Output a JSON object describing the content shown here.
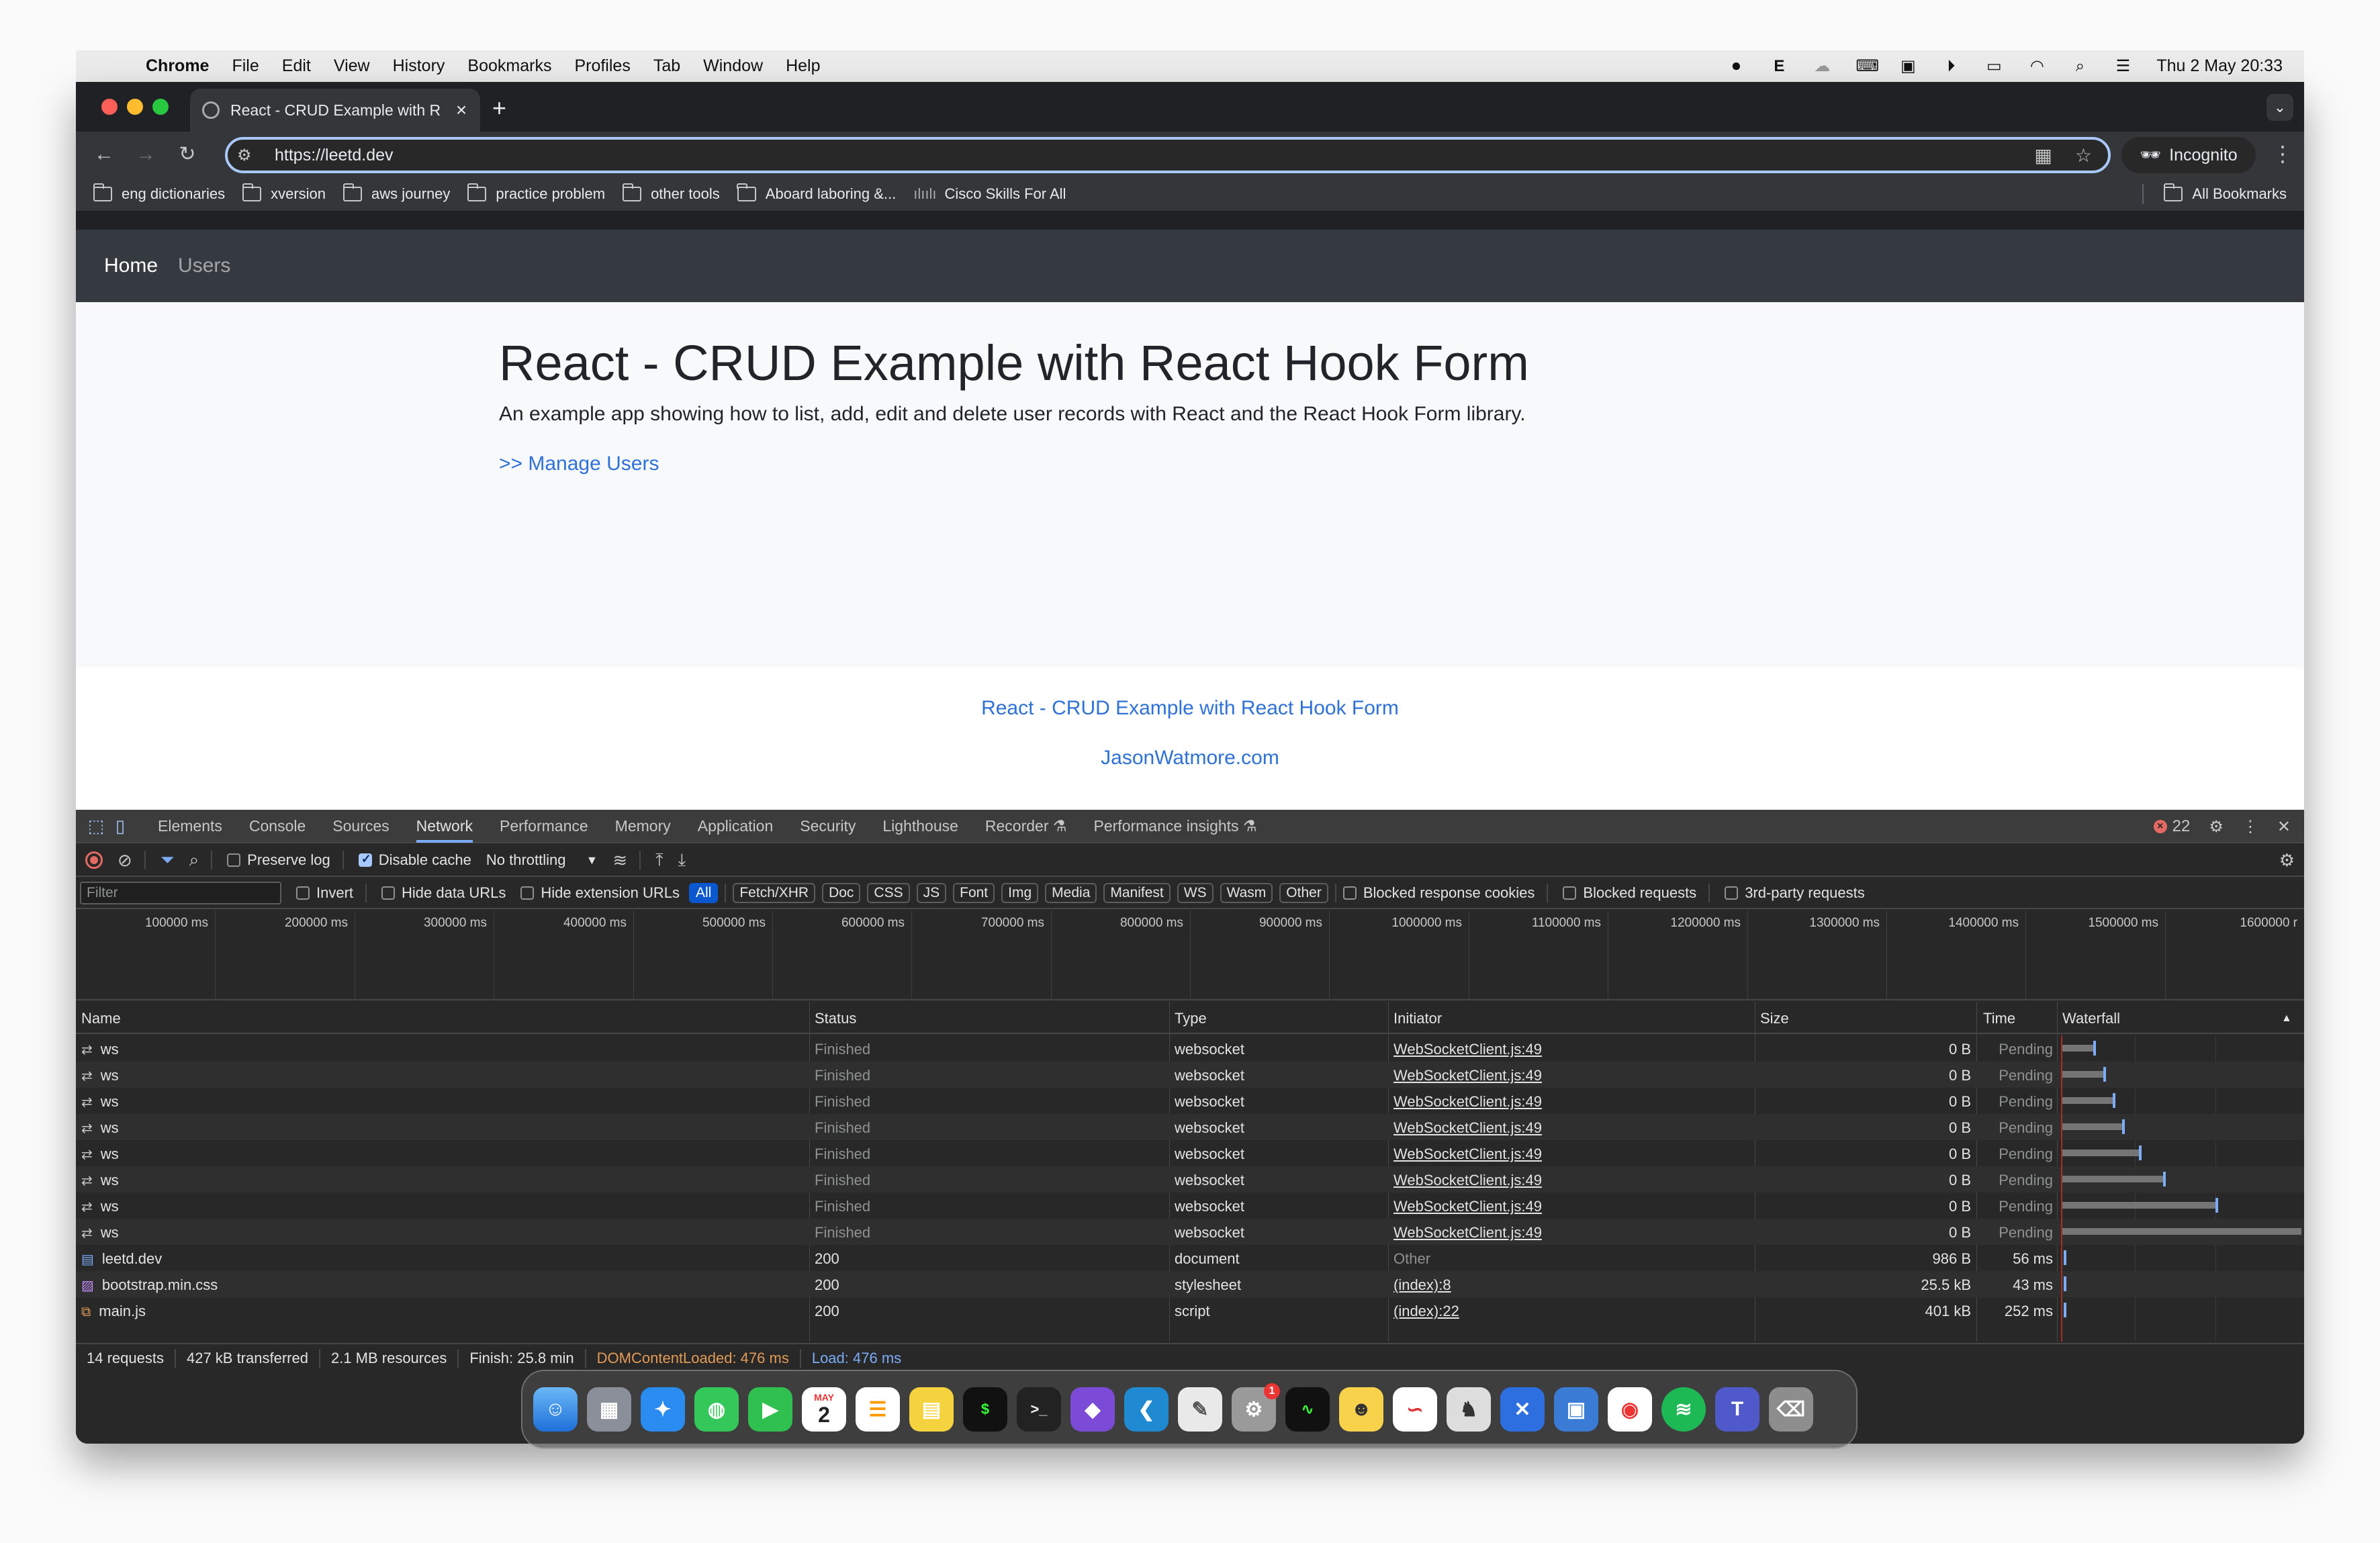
{
  "menubar": {
    "items": [
      "Chrome",
      "File",
      "Edit",
      "View",
      "History",
      "Bookmarks",
      "Profiles",
      "Tab",
      "Window",
      "Help"
    ],
    "datetime": "Thu 2 May  20:33"
  },
  "tab": {
    "title": "React - CRUD Example with R"
  },
  "omnibox": {
    "url": "https://leetd.dev"
  },
  "incognito_label": "Incognito",
  "bookmarks": [
    "eng dictionaries",
    "xversion",
    "aws journey",
    "practice problem",
    "other tools",
    "Aboard laboring &...",
    "Cisco Skills For All"
  ],
  "all_bookmarks": "All Bookmarks",
  "app": {
    "nav_home": "Home",
    "nav_users": "Users",
    "title": "React - CRUD Example with React Hook Form",
    "lead": "An example app showing how to list, add, edit and delete user records with React and the React Hook Form library.",
    "manage_link": ">> Manage Users",
    "footer_link1": "React - CRUD Example with React Hook Form",
    "footer_link2": "JasonWatmore.com"
  },
  "devtools": {
    "tabs": [
      "Elements",
      "Console",
      "Sources",
      "Network",
      "Performance",
      "Memory",
      "Application",
      "Security",
      "Lighthouse",
      "Recorder ⚗",
      "Performance insights ⚗"
    ],
    "active_tab": "Network",
    "error_count": "22",
    "toolbar": {
      "preserve_log": "Preserve log",
      "disable_cache": "Disable cache",
      "throttling": "No throttling"
    },
    "filter": {
      "placeholder": "Filter",
      "invert": "Invert",
      "hide_data_urls": "Hide data URLs",
      "hide_ext_urls": "Hide extension URLs",
      "types": [
        "All",
        "Fetch/XHR",
        "Doc",
        "CSS",
        "JS",
        "Font",
        "Img",
        "Media",
        "Manifest",
        "WS",
        "Wasm",
        "Other"
      ],
      "blocked_cookies": "Blocked response cookies",
      "blocked_requests": "Blocked requests",
      "third_party": "3rd-party requests"
    },
    "overview_ticks": [
      "100000 ms",
      "200000 ms",
      "300000 ms",
      "400000 ms",
      "500000 ms",
      "600000 ms",
      "700000 ms",
      "800000 ms",
      "900000 ms",
      "1000000 ms",
      "1100000 ms",
      "1200000 ms",
      "1300000 ms",
      "1400000 ms",
      "1500000 ms",
      "1600000 r"
    ],
    "columns": [
      "Name",
      "Status",
      "Type",
      "Initiator",
      "Size",
      "Time",
      "Waterfall"
    ],
    "rows": [
      {
        "name": "ws",
        "status": "Finished",
        "type": "websocket",
        "initiator": "WebSocketClient.js:49",
        "size": "0 B",
        "time": "Pending",
        "wf": 0.13
      },
      {
        "name": "ws",
        "status": "Finished",
        "type": "websocket",
        "initiator": "WebSocketClient.js:49",
        "size": "0 B",
        "time": "Pending",
        "wf": 0.17
      },
      {
        "name": "ws",
        "status": "Finished",
        "type": "websocket",
        "initiator": "WebSocketClient.js:49",
        "size": "0 B",
        "time": "Pending",
        "wf": 0.21
      },
      {
        "name": "ws",
        "status": "Finished",
        "type": "websocket",
        "initiator": "WebSocketClient.js:49",
        "size": "0 B",
        "time": "Pending",
        "wf": 0.25
      },
      {
        "name": "ws",
        "status": "Finished",
        "type": "websocket",
        "initiator": "WebSocketClient.js:49",
        "size": "0 B",
        "time": "Pending",
        "wf": 0.32
      },
      {
        "name": "ws",
        "status": "Finished",
        "type": "websocket",
        "initiator": "WebSocketClient.js:49",
        "size": "0 B",
        "time": "Pending",
        "wf": 0.42
      },
      {
        "name": "ws",
        "status": "Finished",
        "type": "websocket",
        "initiator": "WebSocketClient.js:49",
        "size": "0 B",
        "time": "Pending",
        "wf": 0.64
      },
      {
        "name": "ws",
        "status": "Finished",
        "type": "websocket",
        "initiator": "WebSocketClient.js:49",
        "size": "0 B",
        "time": "Pending",
        "wf": 1.0
      },
      {
        "name": "leetd.dev",
        "status": "200",
        "type": "document",
        "initiator": "Other",
        "size": "986 B",
        "time": "56 ms",
        "wf": 0
      },
      {
        "name": "bootstrap.min.css",
        "status": "200",
        "type": "stylesheet",
        "initiator": "(index):8",
        "size": "25.5 kB",
        "time": "43 ms",
        "wf": 0
      },
      {
        "name": "main.js",
        "status": "200",
        "type": "script",
        "initiator": "(index):22",
        "size": "401 kB",
        "time": "252 ms",
        "wf": 0
      }
    ],
    "status": {
      "requests": "14 requests",
      "transferred": "427 kB transferred",
      "resources": "2.1 MB resources",
      "finish": "Finish: 25.8 min",
      "dcl": "DOMContentLoaded: 476 ms",
      "load": "Load: 476 ms"
    }
  },
  "dock": {
    "calendar_month": "MAY",
    "calendar_day": "2",
    "badge": "1"
  }
}
